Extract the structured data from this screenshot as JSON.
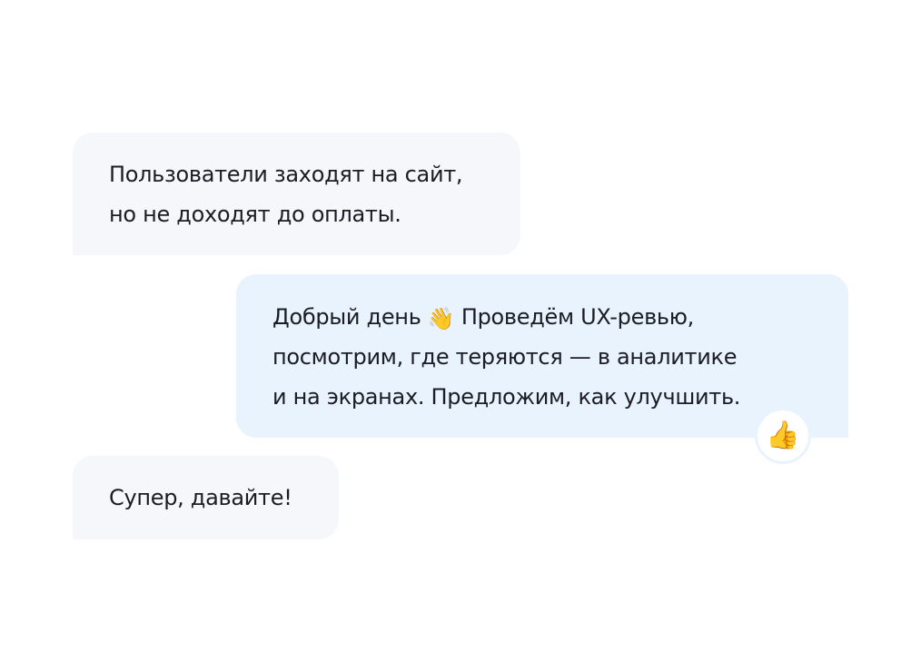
{
  "messages": [
    {
      "direction": "incoming",
      "lines": [
        "Пользователи заходят на сайт,",
        "но не доходят до оплаты."
      ]
    },
    {
      "direction": "outgoing",
      "line1_before": "Добрый день",
      "line1_emoji": "👋",
      "line1_after": "Проведём UX-ревью,",
      "lines_rest": [
        "посмотрим, где теряются — в аналитике",
        "и на экранах. Предложим, как улучшить."
      ],
      "reaction": "👍"
    },
    {
      "direction": "incoming",
      "lines": [
        "Супер, давайте!"
      ]
    }
  ],
  "colors": {
    "incoming_bubble": "#f6f7fb",
    "outgoing_bubble": "#e8f3fe",
    "text": "#1c1c24",
    "background": "#ffffff"
  }
}
